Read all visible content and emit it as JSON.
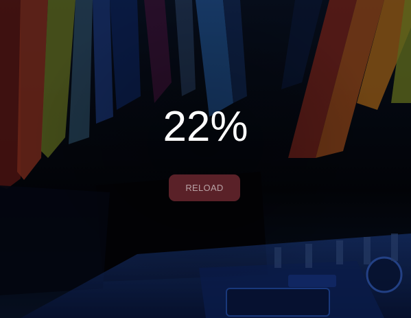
{
  "loader": {
    "progress_text": "22%",
    "progress_fraction": 0.22
  },
  "actions": {
    "reload_label": "RELOAD"
  },
  "background": {
    "subject": "electronics-cables-photo"
  },
  "colors": {
    "button_bg": "#5a2128",
    "button_text": "#b9a3a6",
    "text": "#ffffff"
  }
}
